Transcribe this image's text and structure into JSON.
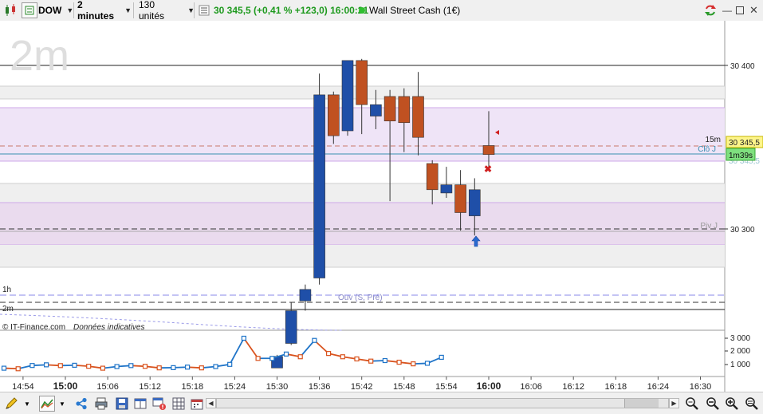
{
  "toolbar": {
    "symbol": "DOW",
    "timeframe": "2 minutes",
    "units": "130 unités",
    "quote": "30 345,5 (+0,41 % +123,0) 16:00:21",
    "instrument": "Wall Street Cash (1€)"
  },
  "chart": {
    "watermark": "2m",
    "copyright": "© IT-Finance.com",
    "disclaimer": "Données indicatives",
    "price_label": "30 345,5",
    "countdown": "1m39s",
    "hidden_price": "30 345,5",
    "labels": {
      "tf15": "15m",
      "clo": "Clô J",
      "piv": "Piv J",
      "ouv": "Ouv (S, Pré)",
      "tf1h": "1h",
      "tf2m": "2m"
    },
    "price_ticks": [
      "30 400",
      "30 300"
    ],
    "volume_ticks": [
      "3 000",
      "2 000",
      "1 000"
    ],
    "time_ticks": [
      "14:54",
      "15:00",
      "15:06",
      "15:12",
      "15:18",
      "15:24",
      "15:30",
      "15:36",
      "15:42",
      "15:48",
      "15:54",
      "16:00",
      "16:06",
      "16:12",
      "16:18",
      "16:24",
      "16:30"
    ]
  },
  "chart_data": {
    "type": "candlestick",
    "ylim": [
      30215,
      30463
    ],
    "candles": [
      {
        "t": "15:30",
        "o": 30215,
        "h": 30223,
        "l": 30215,
        "c": 30222
      },
      {
        "t": "15:32",
        "o": 30230,
        "h": 30255,
        "l": 30229,
        "c": 30250
      },
      {
        "t": "15:34",
        "o": 30256,
        "h": 30266,
        "l": 30250,
        "c": 30263
      },
      {
        "t": "15:36",
        "o": 30270,
        "h": 30395,
        "l": 30266,
        "c": 30382
      },
      {
        "t": "15:38",
        "o": 30382,
        "h": 30384,
        "l": 30352,
        "c": 30357
      },
      {
        "t": "15:40",
        "o": 30360,
        "h": 30389,
        "l": 30357,
        "c": 30403
      },
      {
        "t": "15:42",
        "o": 30403,
        "h": 30404,
        "l": 30358,
        "c": 30376
      },
      {
        "t": "15:44",
        "o": 30369,
        "h": 30385,
        "l": 30361,
        "c": 30376
      },
      {
        "t": "15:46",
        "o": 30381,
        "h": 30385,
        "l": 30317,
        "c": 30366
      },
      {
        "t": "15:48",
        "o": 30381,
        "h": 30386,
        "l": 30347,
        "c": 30365
      },
      {
        "t": "15:50",
        "o": 30381,
        "h": 30396,
        "l": 30345,
        "c": 30356
      },
      {
        "t": "15:52",
        "o": 30340,
        "h": 30342,
        "l": 30315,
        "c": 30324
      },
      {
        "t": "15:54",
        "o": 30322,
        "h": 30338,
        "l": 30319,
        "c": 30327
      },
      {
        "t": "15:56",
        "o": 30327,
        "h": 30336,
        "l": 30299,
        "c": 30310
      },
      {
        "t": "15:58",
        "o": 30308,
        "h": 30331,
        "l": 30296,
        "c": 30324
      },
      {
        "t": "16:00",
        "o": 30351,
        "h": 30372,
        "l": 30338,
        "c": 30345.5
      }
    ],
    "volume": {
      "ylim": [
        0,
        3500
      ],
      "values": [
        250,
        200,
        500,
        560,
        490,
        520,
        430,
        250,
        400,
        490,
        420,
        280,
        300,
        350,
        280,
        400,
        600,
        3000,
        1150,
        1150,
        1550,
        1300,
        2800,
        1600,
        1300,
        1100,
        900,
        950,
        800,
        650,
        700,
        1250
      ]
    }
  },
  "colors": {
    "up": "#1f4fa8",
    "down": "#c05121",
    "band": "#cfb8e6",
    "volume_up": "#1f74c8",
    "volume_down": "#d9531e"
  }
}
